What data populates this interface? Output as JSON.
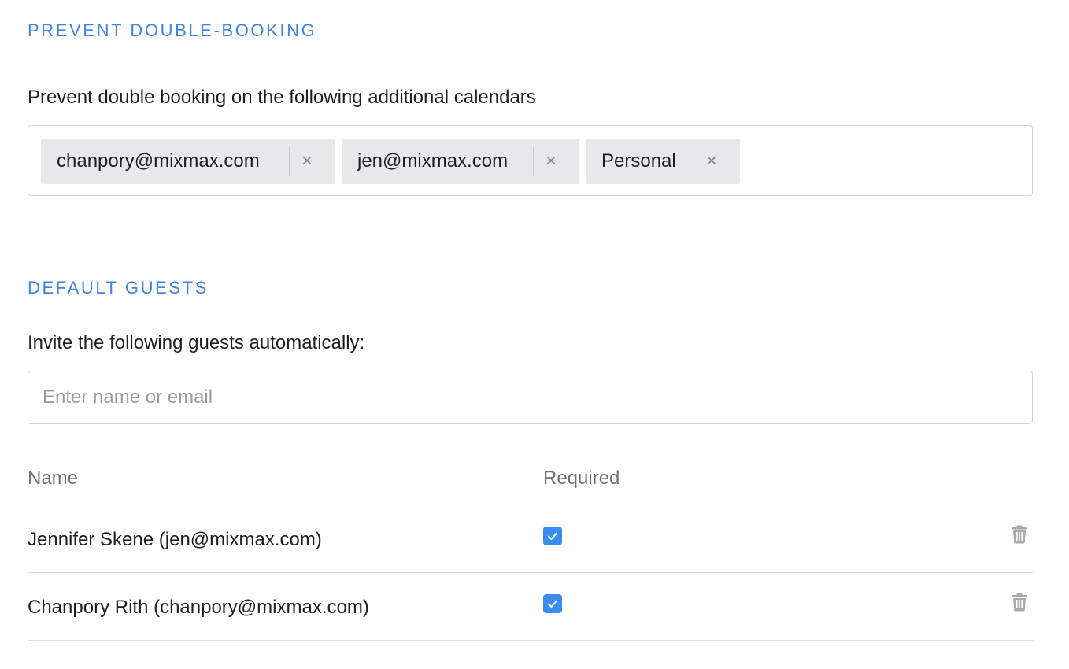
{
  "prevent_double_booking": {
    "title": "PREVENT DOUBLE-BOOKING",
    "label": "Prevent double booking on the following additional calendars",
    "calendars": [
      {
        "label": "chanpory@mixmax.com",
        "remove": "×"
      },
      {
        "label": "jen@mixmax.com",
        "remove": "×"
      },
      {
        "label": "Personal",
        "remove": "×"
      }
    ]
  },
  "default_guests": {
    "title": "DEFAULT GUESTS",
    "label": "Invite the following guests automatically:",
    "input_placeholder": "Enter name or email",
    "input_value": "",
    "columns": {
      "name": "Name",
      "required": "Required"
    },
    "guests": [
      {
        "name": "Jennifer Skene (jen@mixmax.com)",
        "required": true,
        "delete_icon": "trash-icon"
      },
      {
        "name": "Chanpory Rith (chanpory@mixmax.com)",
        "required": true,
        "delete_icon": "trash-icon"
      }
    ]
  },
  "colors": {
    "section_title": "#3d85e0",
    "checkbox": "#3b8cf0",
    "tag_bg": "#e8e8ec",
    "trash": "#a9aaae"
  }
}
